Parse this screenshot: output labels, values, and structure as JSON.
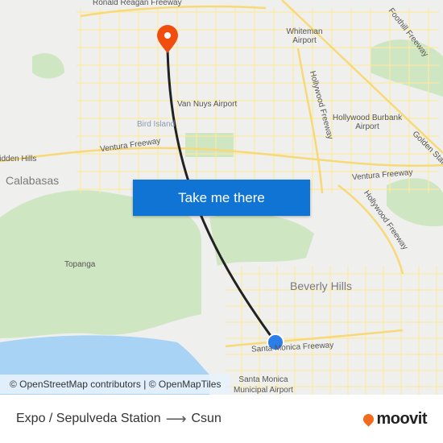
{
  "map": {
    "labels": {
      "ronald_reagan": "Ronald Reagan Freeway",
      "whiteman": "Whiteman Airport",
      "foothill": "Foothill Freeway",
      "hollywood_fwy_1": "Hollywood Freeway",
      "van_nuys": "Van Nuys Airport",
      "bird_island": "Bird Island",
      "burbank": "Hollywood Burbank Airport",
      "golden_state": "Golden State",
      "ventura_fwy_1": "Ventura Freeway",
      "hidden_hills": "Hidden Hills",
      "calabasas": "Calabasas",
      "ventura_fwy_2": "Ventura Freeway",
      "hollywood_fwy_2": "Hollywood Freeway",
      "topanga": "Topanga",
      "beverly_hills": "Beverly Hills",
      "santa_monica_fwy": "Santa Monica Freeway",
      "smo_airport": "Santa Monica Municipal Airport"
    },
    "attribution": "© OpenStreetMap contributors | © OpenMapTiles",
    "origin_color": "#2b7de9",
    "destination_color": "#f04e0e",
    "route_color": "#222222"
  },
  "cta": {
    "label": "Take me there"
  },
  "footer": {
    "origin": "Expo / Sepulveda Station",
    "arrow": "⟶",
    "destination": "Csun",
    "brand": "moovit"
  }
}
